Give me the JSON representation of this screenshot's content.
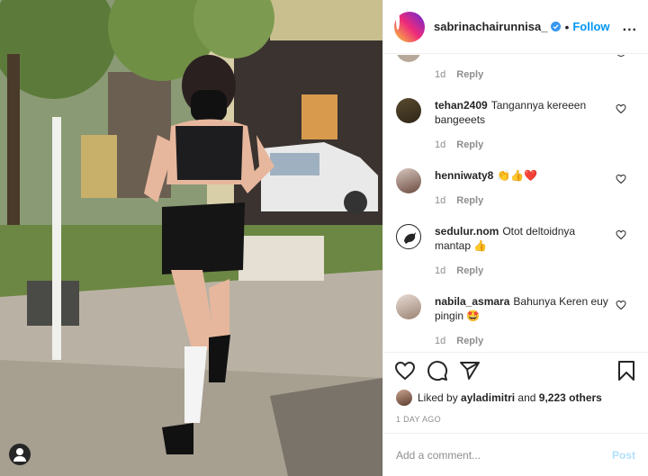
{
  "post": {
    "username": "sabrinachairunnisa_",
    "verified": true,
    "separator": "•",
    "follow_label": "Follow",
    "more_label": "...",
    "photo_icon": "user-tag-icon"
  },
  "comments_top": {
    "time": "1d",
    "reply": "Reply"
  },
  "comments": [
    {
      "username": "tehan2409",
      "text": "Tangannya kereeen bangeeets",
      "time": "1d",
      "reply": "Reply"
    },
    {
      "username": "henniwaty8",
      "text": "👏👍❤️",
      "time": "1d",
      "reply": "Reply"
    },
    {
      "username": "sedulur.nom",
      "text": "Otot deltoidnya mantap 👍",
      "time": "1d",
      "reply": "Reply"
    },
    {
      "username": "nabila_asmara",
      "text": "Bahunya Keren euy pingin 🤩",
      "time": "1d",
      "reply": "Reply"
    }
  ],
  "likes": {
    "prefix": "Liked by",
    "user": "ayladimitri",
    "joiner": "and",
    "count": "9,223 others"
  },
  "date": "1 DAY AGO",
  "add_comment": {
    "placeholder": "Add a comment...",
    "post_label": "Post"
  },
  "colors": {
    "link": "#0095f6",
    "muted": "#8e8e8e",
    "post_disabled": "#b2dffc"
  }
}
